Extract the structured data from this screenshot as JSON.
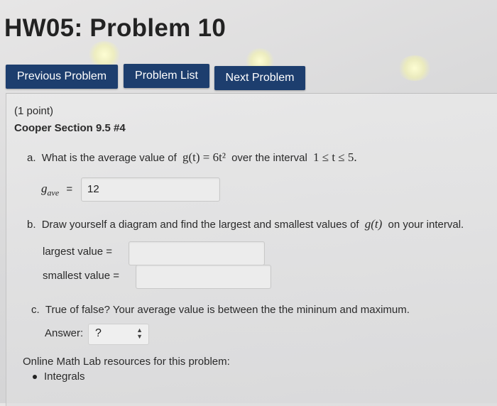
{
  "page": {
    "title": "HW05: Problem 10"
  },
  "nav": {
    "previous_label": "Previous Problem",
    "list_label": "Problem List",
    "next_label": "Next Problem"
  },
  "problem": {
    "points": "(1 point)",
    "source": "Cooper Section 9.5 #4",
    "part_a": {
      "letter": "a.",
      "text_before": "What is the average value of",
      "function": "g(t) = 6t²",
      "text_mid": "over the interval",
      "interval": "1 ≤ t ≤ 5.",
      "answer_label": "g",
      "answer_sub": "ave",
      "equals": "=",
      "answer_value": "12"
    },
    "part_b": {
      "letter": "b.",
      "text": "Draw yourself a diagram and find the largest and smallest values of",
      "function": "g(t)",
      "text_after": "on your interval.",
      "largest_label": "largest value =",
      "largest_value": "",
      "smallest_label": "smallest value =",
      "smallest_value": ""
    },
    "part_c": {
      "letter": "c.",
      "text": "True of false? Your average value is between the the mininum and maximum.",
      "answer_label": "Answer:",
      "answer_value": "?"
    },
    "resources": {
      "heading": "Online Math Lab resources for this problem:",
      "items": [
        "Integrals"
      ]
    }
  },
  "colors": {
    "nav_button": "#1d3e6e",
    "background": "#dcdcdd"
  }
}
